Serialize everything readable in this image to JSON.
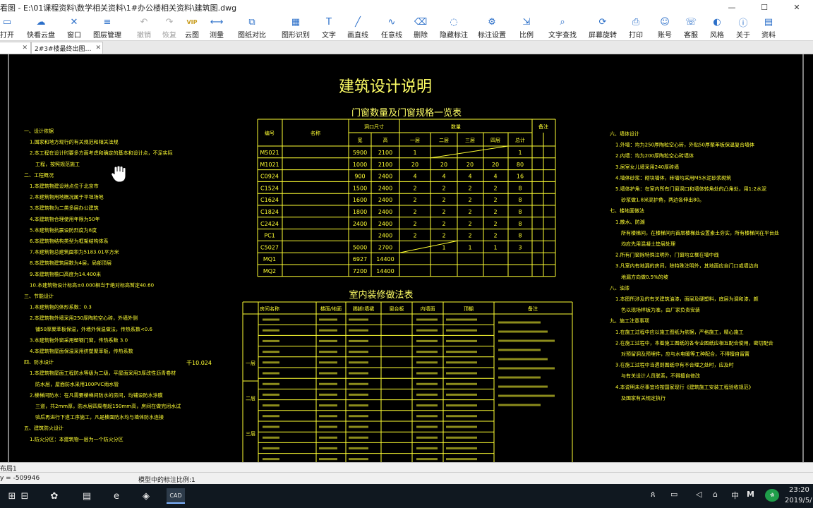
{
  "window": {
    "title": "看图 - E:\\01课程资料\\数学相关资料\\1#办公楼相关资料\\建筑图.dwg",
    "minimize": "—",
    "maximize": "☐",
    "close": "✕"
  },
  "toolbar": [
    {
      "label": "打开",
      "icon": "folder-open-icon",
      "glyph": "▭",
      "state": "normal"
    },
    {
      "label": "快看云盘",
      "icon": "cloud-icon",
      "glyph": "☁",
      "state": "normal"
    },
    {
      "label": "窗口",
      "icon": "window-icon",
      "glyph": "✕",
      "state": "normal"
    },
    {
      "label": "图层管理",
      "icon": "layers-icon",
      "glyph": "≡",
      "state": "normal"
    },
    {
      "label": "撤销",
      "icon": "undo-icon",
      "glyph": "↶",
      "state": "disabled"
    },
    {
      "label": "恢复",
      "icon": "redo-icon",
      "glyph": "↷",
      "state": "disabled"
    },
    {
      "label": "云图",
      "icon": "vip-icon",
      "glyph": "VIP",
      "state": "vip"
    },
    {
      "label": "测量",
      "icon": "measure-icon",
      "glyph": "⟷",
      "state": "normal"
    },
    {
      "label": "图纸对比",
      "icon": "compare-icon",
      "glyph": "⧉",
      "state": "normal"
    },
    {
      "label": "图形识别",
      "icon": "recognize-icon",
      "glyph": "▦",
      "state": "normal"
    },
    {
      "label": "文字",
      "icon": "text-icon",
      "glyph": "T",
      "state": "normal"
    },
    {
      "label": "画直线",
      "icon": "line-icon",
      "glyph": "╱",
      "state": "normal"
    },
    {
      "label": "任意线",
      "icon": "freehand-icon",
      "glyph": "∿",
      "state": "normal"
    },
    {
      "label": "删除",
      "icon": "eraser-icon",
      "glyph": "⌫",
      "state": "normal"
    },
    {
      "label": "隐藏标注",
      "icon": "hide-annotation-icon",
      "glyph": "◌",
      "state": "normal"
    },
    {
      "label": "标注设置",
      "icon": "annotation-settings-icon",
      "glyph": "⚙",
      "state": "normal"
    },
    {
      "label": "比例",
      "icon": "scale-icon",
      "glyph": "⇲",
      "state": "normal"
    },
    {
      "label": "文字查找",
      "icon": "text-search-icon",
      "glyph": "⌕",
      "state": "normal"
    },
    {
      "label": "屏幕旋转",
      "icon": "rotate-icon",
      "glyph": "⟳",
      "state": "normal"
    },
    {
      "label": "打印",
      "icon": "print-icon",
      "glyph": "⎙",
      "state": "normal"
    },
    {
      "label": "账号",
      "icon": "account-icon",
      "glyph": "☺",
      "state": "normal"
    },
    {
      "label": "客服",
      "icon": "support-icon",
      "glyph": "☏",
      "state": "normal"
    },
    {
      "label": "风格",
      "icon": "style-icon",
      "glyph": "◐",
      "state": "normal"
    },
    {
      "label": "关于",
      "icon": "info-icon",
      "glyph": "ⓘ",
      "state": "normal"
    },
    {
      "label": "资料",
      "icon": "docs-icon",
      "glyph": "▤",
      "state": "normal"
    }
  ],
  "tabs": [
    {
      "label": "",
      "close": "✕"
    },
    {
      "label": "2#3#楼最终出图…",
      "close": "✕"
    }
  ],
  "drawing": {
    "main_title": "建筑设计说明",
    "door_table": {
      "title": "门窗数量及门窗规格一览表",
      "headers": [
        "编号",
        "名称",
        "洞口尺寸",
        "宽",
        "高",
        "数量",
        "一层",
        "二层",
        "三层",
        "四层",
        "总计",
        "备注"
      ],
      "rows": [
        [
          "M5021",
          "",
          "5900",
          "2100",
          "1",
          "",
          "",
          "",
          "1",
          ""
        ],
        [
          "M1021",
          "",
          "1000",
          "2100",
          "20",
          "20",
          "20",
          "20",
          "80",
          ""
        ],
        [
          "C0924",
          "",
          "900",
          "2400",
          "4",
          "4",
          "4",
          "4",
          "16",
          ""
        ],
        [
          "C1524",
          "",
          "1500",
          "2400",
          "2",
          "2",
          "2",
          "2",
          "8",
          ""
        ],
        [
          "C1624",
          "",
          "1600",
          "2400",
          "2",
          "2",
          "2",
          "2",
          "8",
          ""
        ],
        [
          "C1824",
          "",
          "1800",
          "2400",
          "2",
          "2",
          "2",
          "2",
          "8",
          ""
        ],
        [
          "C2424",
          "",
          "2400",
          "2400",
          "2",
          "2",
          "2",
          "2",
          "8",
          ""
        ],
        [
          "PC1",
          "",
          "",
          "2400",
          "2",
          "2",
          "2",
          "2",
          "8",
          ""
        ],
        [
          "C5027",
          "",
          "5000",
          "2700",
          "",
          "1",
          "1",
          "1",
          "3",
          ""
        ],
        [
          "MQ1",
          "",
          "6927",
          "14400",
          "",
          "",
          "",
          "",
          "",
          ""
        ],
        [
          "MQ2",
          "",
          "7200",
          "14400",
          "",
          "",
          "",
          "",
          "",
          ""
        ]
      ]
    },
    "finish_table": {
      "title": "室内装修做法表",
      "headers": [
        "房间名称",
        "楼面/地面",
        "踢脚/墙裙",
        "窗台板",
        "内墙面",
        "顶棚",
        "备注"
      ],
      "floor_labels": [
        "一层",
        "二层",
        "三层"
      ]
    },
    "left_notes": [
      "一、设计依据",
      "1.国家和地方现行的有关规范和相关法规",
      "2.本工程在设计时要多方面考虑和确定的基本和设计点，不足实际",
      "工程，按照规范施工",
      "二、工程概况",
      "1.本建筑物建设地点位于北京市",
      "2.本建筑物用地概况属于平坦场地",
      "3.本建筑物为二类多层办公建筑",
      "4.本建筑物合理使用年限为50年",
      "5.本建筑物抗震设防烈度为8度",
      "6.本建筑物结构类型为框架结构体系",
      "7.本建筑物总建筑面积为5183.01平方米",
      "8.本建筑物建筑层数为4层，局部顶层",
      "9.本建筑物檐口高度为14.400米",
      "10.本建筑物设计标高±0.000相当于绝对标高暂定40.60",
      "三、节能设计",
      "1.本建筑物的体形系数：0.3",
      "2.本建筑物外墙采用250厚陶粒空心砖，外墙外侧",
      "铺50厚聚苯板保温，外墙外保温做法，传热系数<0.6",
      "3.本建筑物外窗采用塑钢门窗，传热系数  3.0",
      "4.本建筑物屋面保温采用挤塑聚苯板，传热系数",
      "四、防水设计",
      "1.本建筑物屋面工程防水等级为二级，平屋面采用3厚改性沥青卷材",
      "防水层，屋面防水采用100PVC雨水管",
      "2.楼梯间防水：在凡需要楼梯间防水的房间，均铺设防水涂膜",
      "三道，共2mm厚，防水层四周卷起150mm高，房间在做完闭水试",
      "验后再进行下道工序施工，凡是楼面防水均与墙体防水连接",
      "五、建筑防火设计",
      "1.防火分区：本建筑物一层为一个防火分区"
    ],
    "right_notes": [
      "六、墙体设计",
      "1.外墙：均为250厚陶粒空心砖，外贴50厚聚苯板保温复合墙体",
      "2.内墙：均为200厚陶粒空心砖墙体",
      "3.居室女儿墙采用240厚砖墙",
      "4.墙体砂浆：砌块墙体，砖墙均采用M5水泥砂浆砌筑",
      "5.墙体护角：在室内所有门窗洞口和墙体转角处的凸角处，用1:2水泥",
      "砂浆做1.8米高护角，两边各伸出80。",
      "七、楼地面做法",
      "1.散水、防潮",
      "所有楼梯间，在楼梯间内首层楼梯处设置素土夯实，所有楼梯间在平台处",
      "均应先用混凝土垫层处理",
      "2.所有门窗除特殊注明外，门窗均立框在墙中线",
      "3.凡室内有地漏的房间，除特殊注明外，其地面应自门口或墙边向",
      "地漏方向做0.5%的坡",
      "八、油漆",
      "1.本图所涉及的有关建筑油漆，面层及硬塑料，底层为调和漆，颜",
      "色以现场样板为准，由厂家负责安装",
      "九、施工注意事项",
      "1.在施工过程中应以施工图纸为依据，严格施工，精心施工",
      "2.在施工过程中，本着施工图纸的各专业图纸应相互配合使用，密切配合",
      "对预留洞及预埋件，应与水电暖等工种配合，不得擅自留置",
      "3.在施工过程中当遇到图纸中有不合理之处时，应及时",
      "与有关设计人员联系，不得擅自修改",
      "4.本说明未尽事宜均按国家现行《建筑施工安装工程验收规范》",
      "及国家有关规定执行"
    ],
    "scale_text": "千10.024",
    "cursor_icon": "hand-cursor-icon"
  },
  "layout_tab": "布局1",
  "status": {
    "coords": "y = -509946",
    "scale_text": "模型中的标注比例:1"
  },
  "taskbar": {
    "items": [
      {
        "name": "start-button",
        "glyph": "⊞"
      },
      {
        "name": "task-view-icon",
        "glyph": "⊟"
      },
      {
        "name": "pinwheel-app-icon",
        "glyph": "✿"
      },
      {
        "name": "file-explorer-icon",
        "glyph": "▤"
      },
      {
        "name": "edge-icon",
        "glyph": "e"
      },
      {
        "name": "whiteboard-app-icon",
        "glyph": "◈"
      },
      {
        "name": "cad-viewer-taskbar-icon",
        "glyph": "CAD"
      }
    ],
    "tray": {
      "ime": "中",
      "clock": "23:20",
      "date": "2019/5/"
    }
  },
  "colors": {
    "drawing_bg": "#000000",
    "cad_yellow": "#ffff33",
    "cad_title": "#ffff66",
    "toolbar_icon": "#2b6fc9"
  }
}
